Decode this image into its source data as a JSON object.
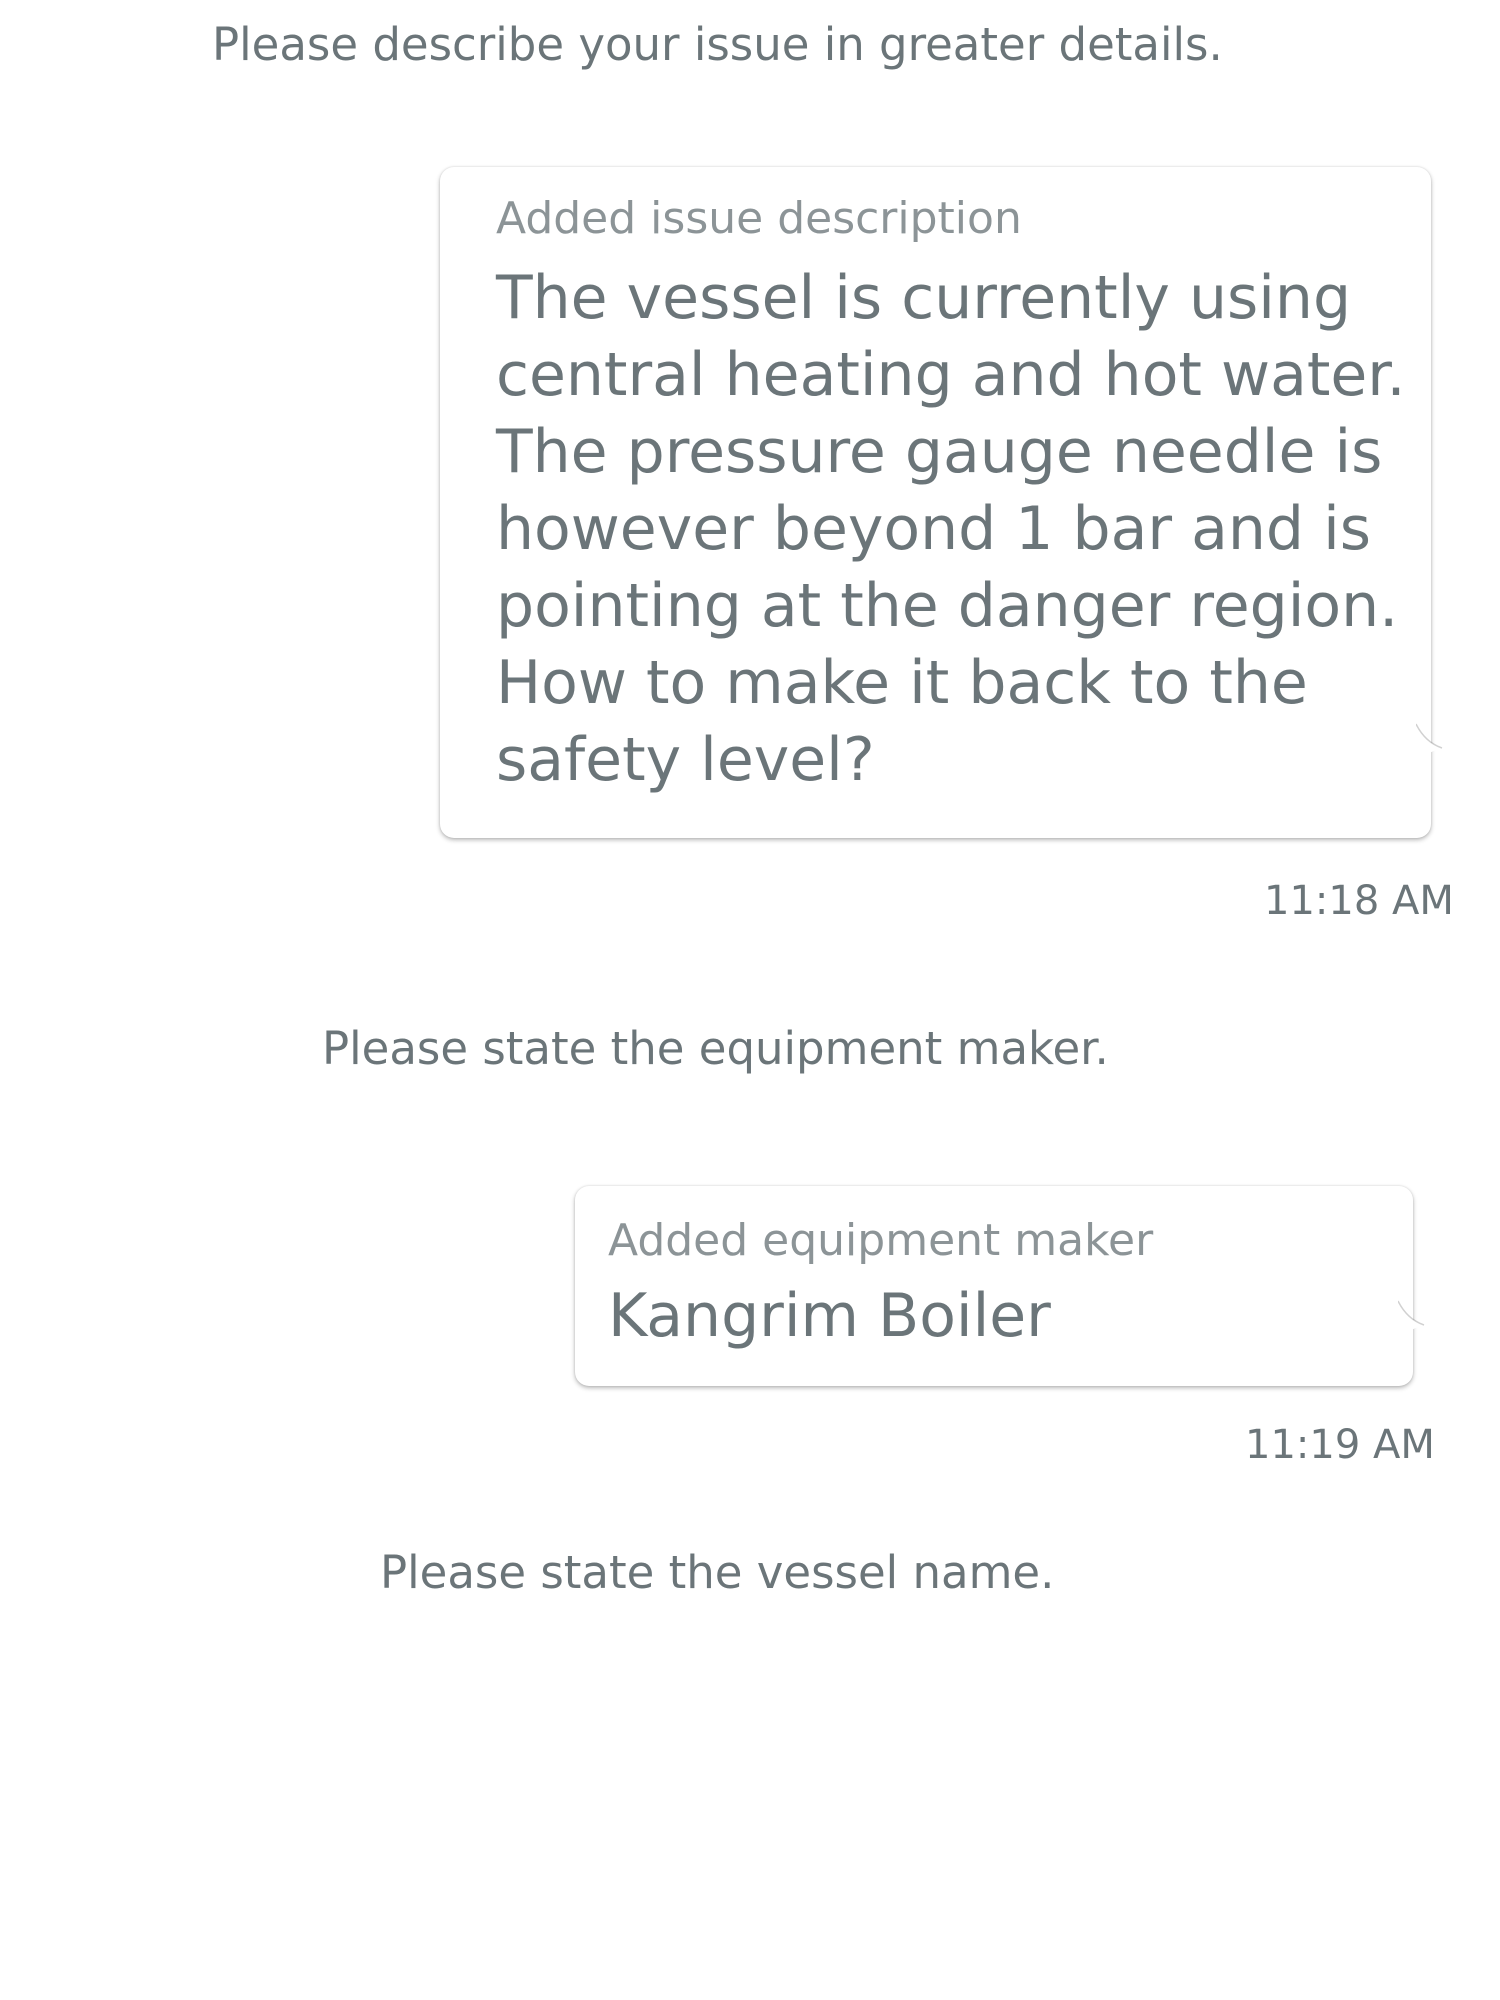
{
  "chat": {
    "prompt_issue": "Please describe your issue in greater details.",
    "reply_issue": {
      "label": "Added issue description",
      "text": "The vessel is currently using central heating and hot water. The pressure gauge needle is however beyond 1 bar and is pointing at the danger region. How to make it back to the safety level?",
      "time": "11:18 AM"
    },
    "prompt_maker": "Please state the equipment maker.",
    "reply_maker": {
      "label": "Added equipment maker",
      "text": "Kangrim Boiler",
      "time": "11:19 AM"
    },
    "prompt_vessel": "Please state the vessel name."
  }
}
